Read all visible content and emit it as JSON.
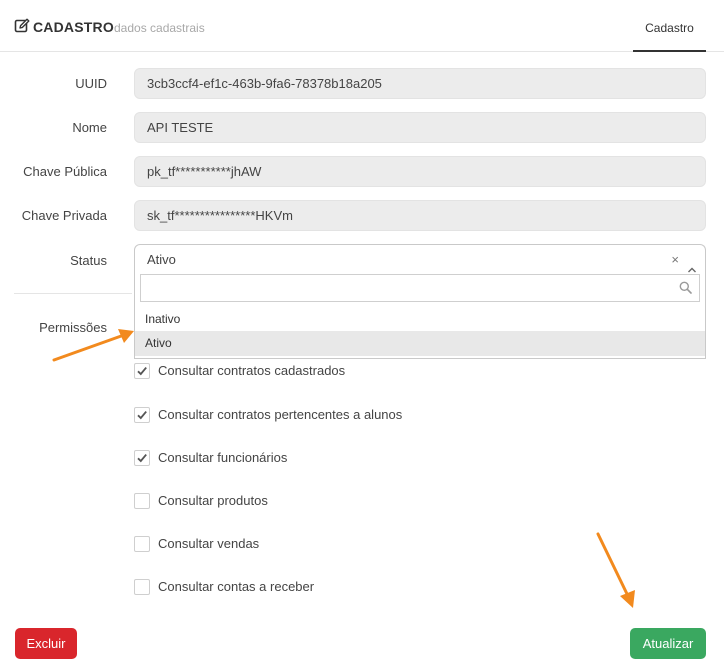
{
  "header": {
    "title": "CADASTRO",
    "subtitle": "dados cadastrais",
    "tab_label": "Cadastro"
  },
  "form": {
    "uuid": {
      "label": "UUID",
      "value": "3cb3ccf4-ef1c-463b-9fa6-78378b18a205"
    },
    "nome": {
      "label": "Nome",
      "value": "API TESTE"
    },
    "chave_publica": {
      "label": "Chave Pública",
      "value": "pk_tf***********jhAW"
    },
    "chave_privada": {
      "label": "Chave Privada",
      "value": "sk_tf****************HKVm"
    },
    "status": {
      "label": "Status",
      "selected": "Ativo",
      "clear_symbol": "×",
      "search_value": "",
      "options": [
        "Inativo",
        "Ativo"
      ],
      "highlighted_option": "Ativo"
    }
  },
  "permissions": {
    "label": "Permissões",
    "items": [
      {
        "label": "Consultar contratos cadastrados",
        "checked": true
      },
      {
        "label": "Consultar contratos pertencentes a alunos",
        "checked": true
      },
      {
        "label": "Consultar funcionários",
        "checked": true
      },
      {
        "label": "Consultar produtos",
        "checked": false
      },
      {
        "label": "Consultar vendas",
        "checked": false
      },
      {
        "label": "Consultar contas a receber",
        "checked": false
      }
    ]
  },
  "footer": {
    "delete_label": "Excluir",
    "update_label": "Atualizar"
  },
  "colors": {
    "danger": "#d9262c",
    "success": "#3aa860",
    "annotation_arrow": "#f28a1e"
  }
}
